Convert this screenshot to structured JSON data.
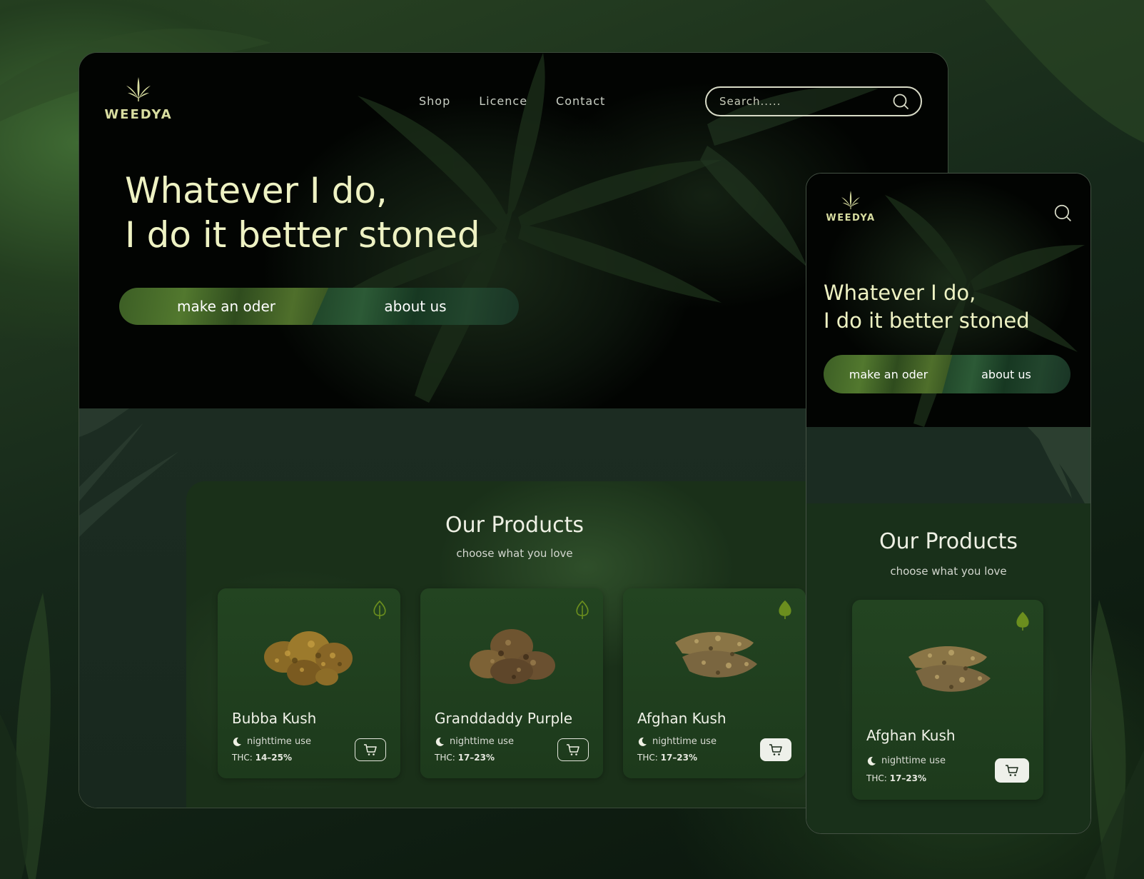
{
  "brand": {
    "name": "WEEDYA"
  },
  "nav": {
    "items": [
      "Shop",
      "Licence",
      "Contact"
    ]
  },
  "search": {
    "placeholder": "Search....."
  },
  "hero": {
    "line1": "Whatever I do,",
    "line2": "I do it better stoned",
    "order_button": "make an oder",
    "about_button": "about us"
  },
  "products": {
    "title": "Our Products",
    "subtitle": "choose what you love",
    "items": [
      {
        "name": "Bubba Kush",
        "use": "nighttime use",
        "thc_label": "THC:",
        "thc_value": "14–25%",
        "favorite": false,
        "cart_style": "outline"
      },
      {
        "name": "Granddaddy Purple",
        "use": "nighttime use",
        "thc_label": "THC:",
        "thc_value": "17–23%",
        "favorite": false,
        "cart_style": "outline"
      },
      {
        "name": "Afghan Kush",
        "use": "nighttime use",
        "thc_label": "THC:",
        "thc_value": "17–23%",
        "favorite": true,
        "cart_style": "filled"
      }
    ]
  },
  "mobile": {
    "brand": "WEEDYA",
    "line1": "Whatever I do,",
    "line2": "I do it better stoned",
    "order_button": "make an oder",
    "about_button": "about us",
    "products_title": "Our Products",
    "products_subtitle": "choose what you love",
    "card": {
      "name": "Afghan Kush",
      "use": "nighttime use",
      "thc_label": "THC:",
      "thc_value": "17–23%",
      "favorite": true
    }
  },
  "colors": {
    "accent": "#eef2c3",
    "leaf_icon": "#6b8e1e",
    "card_bg": "#234421",
    "brand": "#d8dda0"
  },
  "icons": [
    "cannabis-leaf-logo-icon",
    "search-icon",
    "leaf-icon",
    "moon-icon",
    "cart-icon"
  ]
}
